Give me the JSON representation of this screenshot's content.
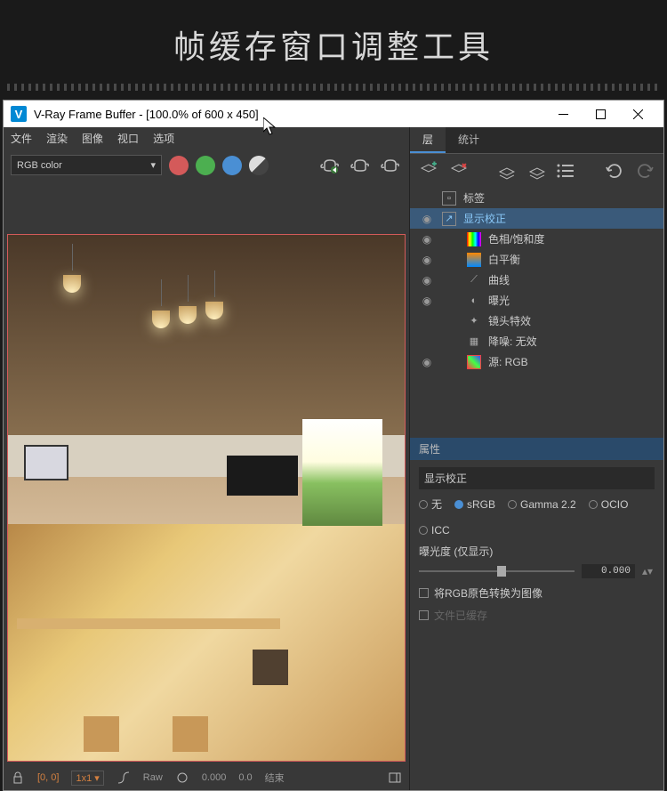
{
  "page_title": "帧缓存窗口调整工具",
  "window": {
    "title": "V-Ray Frame Buffer - [100.0% of 600 x 450]"
  },
  "menu": [
    "文件",
    "渲染",
    "图像",
    "视口",
    "选项"
  ],
  "channel_dropdown": "RGB color",
  "tabs": {
    "layers": "层",
    "stats": "统计"
  },
  "layers": [
    {
      "label": "标签",
      "eye": false
    },
    {
      "label": "显示校正",
      "eye": true,
      "selected": true
    },
    {
      "label": "色相/饱和度",
      "eye": true
    },
    {
      "label": "白平衡",
      "eye": true
    },
    {
      "label": "曲线",
      "eye": true
    },
    {
      "label": "曝光",
      "eye": true
    },
    {
      "label": "镜头特效",
      "eye": false
    },
    {
      "label": "降噪: 无效",
      "eye": false
    },
    {
      "label": "源: RGB",
      "eye": true
    }
  ],
  "properties": {
    "header": "属性",
    "name": "显示校正",
    "options": {
      "none": "无",
      "srgb": "sRGB",
      "gamma": "Gamma 2.2",
      "ocio": "OCIO",
      "icc": "ICC"
    },
    "exposure_label": "曝光度 (仅显示)",
    "exposure_value": "0.000",
    "check1": "将RGB原色转换为图像",
    "check2": "文件已缓存"
  },
  "statusbar": {
    "coords": "[0, 0]",
    "zoom": "1x1",
    "mode": "Raw",
    "v1": "0.000",
    "v2": "0.0",
    "end": "结束"
  }
}
